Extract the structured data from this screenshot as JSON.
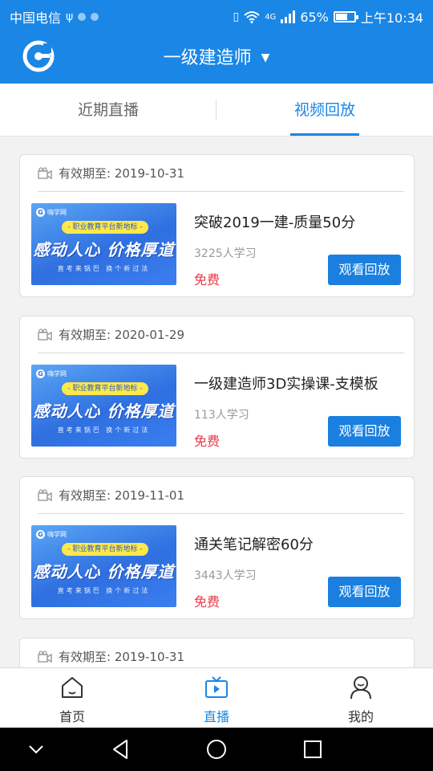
{
  "status_bar": {
    "carrier": "中国电信",
    "network": "4G",
    "battery_percent": "65%",
    "battery_level": 0.65,
    "time": "上午10:34"
  },
  "header": {
    "title": "一级建造师",
    "brand_color": "#1a86e6"
  },
  "tabs": [
    {
      "label": "近期直播",
      "active": false
    },
    {
      "label": "视频回放",
      "active": true
    }
  ],
  "courses": [
    {
      "valid_until": "有效期至: 2019-10-31",
      "title": "突破2019一建-质量50分",
      "learners": "3225人学习",
      "price": "免费",
      "button": "观看回放",
      "thumb": {
        "brand": "嗨学网",
        "pill": "- 职业教育平台新地标 -",
        "headline": "感动人心 价格厚道",
        "tagline": "直考来锅巴 换个新过法"
      }
    },
    {
      "valid_until": "有效期至: 2020-01-29",
      "title": "一级建造师3D实操课-支模板",
      "learners": "113人学习",
      "price": "免费",
      "button": "观看回放",
      "thumb": {
        "brand": "嗨学网",
        "pill": "- 职业教育平台新地标 -",
        "headline": "感动人心 价格厚道",
        "tagline": "直考来锅巴 换个新过法"
      }
    },
    {
      "valid_until": "有效期至: 2019-11-01",
      "title": "通关笔记解密60分",
      "learners": "3443人学习",
      "price": "免费",
      "button": "观看回放",
      "thumb": {
        "brand": "嗨学网",
        "pill": "- 职业教育平台新地标 -",
        "headline": "感动人心 价格厚道",
        "tagline": "直考来锅巴 换个新过法"
      }
    },
    {
      "valid_until": "有效期至: 2019-10-31"
    }
  ],
  "bottom_nav": [
    {
      "label": "首页",
      "icon": "home-icon",
      "active": false
    },
    {
      "label": "直播",
      "icon": "live-tv-icon",
      "active": true
    },
    {
      "label": "我的",
      "icon": "profile-icon",
      "active": false
    }
  ]
}
